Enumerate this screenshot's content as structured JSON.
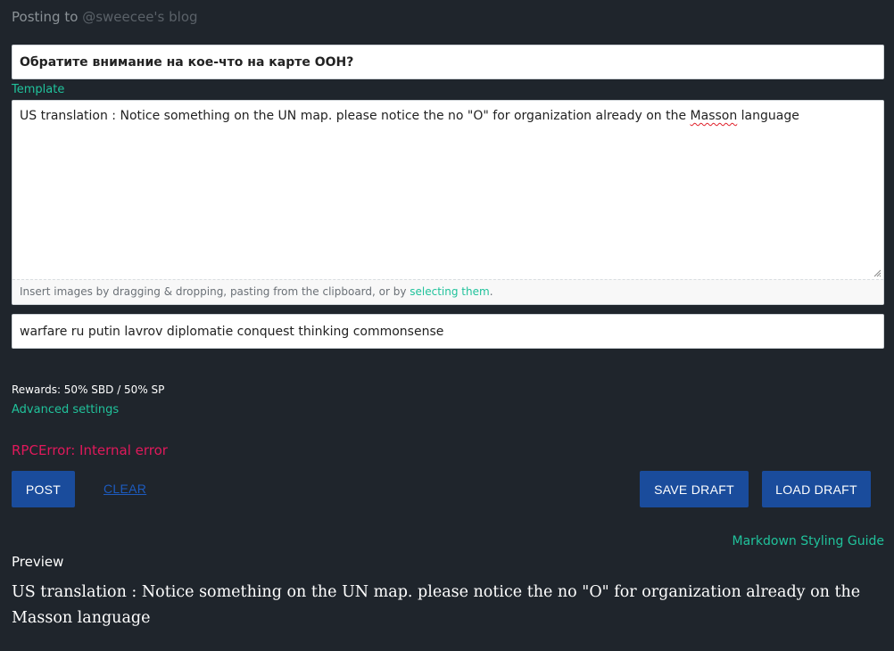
{
  "header": {
    "posting_to_prefix": "Posting to ",
    "blog_name": "@sweecee's blog"
  },
  "title_field": {
    "value": "Обратите внимание на кое-что на карте ООН?"
  },
  "template_link": "Template",
  "body_editor": {
    "text_before": "US translation : Notice something on the UN map. please notice the no \"O\" for organization already on the ",
    "spell_word": "Masson",
    "text_after": " language",
    "dropzone_text": "Insert images by dragging & dropping, pasting from the clipboard, or by ",
    "dropzone_link": "selecting them",
    "dropzone_end": "."
  },
  "tags_field": {
    "value": "warfare ru putin lavrov diplomatie conquest thinking commonsense"
  },
  "rewards_text": "Rewards: 50% SBD / 50% SP",
  "advanced_settings": "Advanced settings",
  "error_text": "RPCError: Internal error",
  "buttons": {
    "post": "POST",
    "clear": "CLEAR",
    "save_draft": "SAVE DRAFT",
    "load_draft": "LOAD DRAFT"
  },
  "markdown_guide": "Markdown Styling Guide",
  "preview": {
    "label": "Preview",
    "body": "US translation : Notice something on the UN map. please notice the no \"O\" for organization already on the Masson language"
  },
  "colors": {
    "background": "#1f252c",
    "accent": "#20c29b",
    "button": "#1a4c9c",
    "error": "#e0195b"
  }
}
